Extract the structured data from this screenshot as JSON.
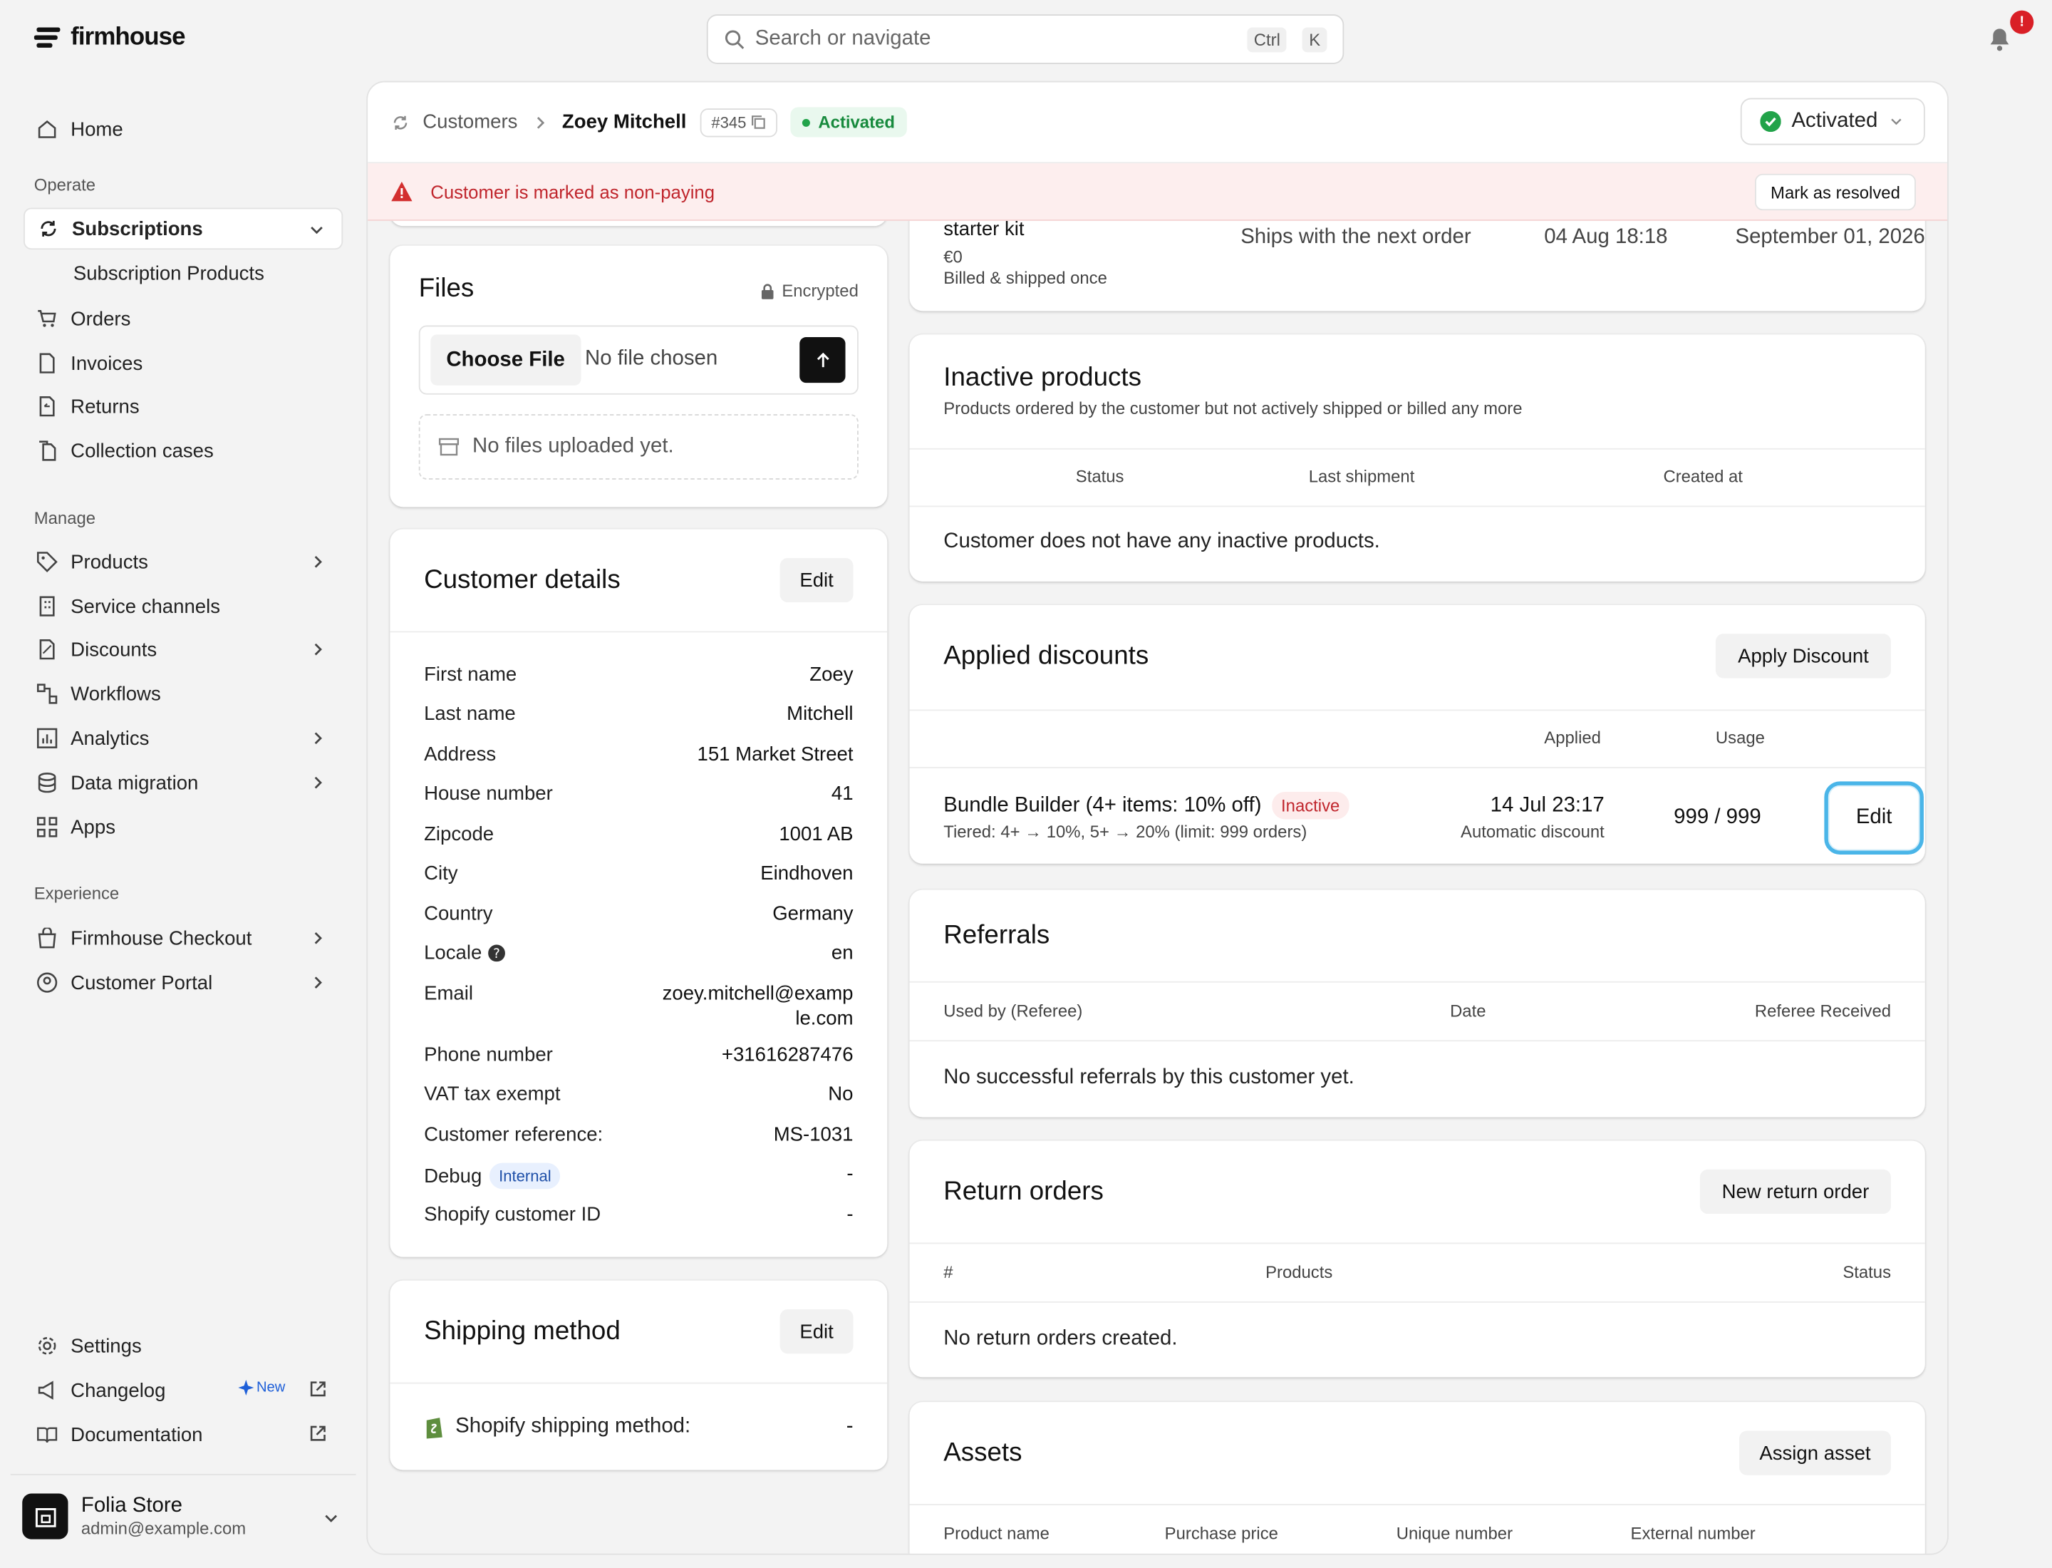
{
  "brand": {
    "name": "firmhouse"
  },
  "search": {
    "placeholder": "Search or navigate",
    "kbd1": "Ctrl",
    "kbd2": "K"
  },
  "notifications": {
    "badge": "!"
  },
  "sidebar": {
    "home": "Home",
    "operate_heading": "Operate",
    "subscriptions": "Subscriptions",
    "subscription_products": "Subscription Products",
    "orders": "Orders",
    "invoices": "Invoices",
    "returns": "Returns",
    "collection_cases": "Collection cases",
    "manage_heading": "Manage",
    "products": "Products",
    "service_channels": "Service channels",
    "discounts": "Discounts",
    "workflows": "Workflows",
    "analytics": "Analytics",
    "data_migration": "Data migration",
    "apps": "Apps",
    "experience_heading": "Experience",
    "firmhouse_checkout": "Firmhouse Checkout",
    "customer_portal": "Customer Portal",
    "settings": "Settings",
    "changelog": "Changelog",
    "changelog_badge": "New",
    "documentation": "Documentation",
    "store_name": "Folia Store",
    "store_email": "admin@example.com"
  },
  "header": {
    "crumb_parent": "Customers",
    "crumb_current": "Zoey Mitchell",
    "customer_id": "#345",
    "status_pill": "Activated",
    "status_dropdown": "Activated"
  },
  "alert": {
    "message": "Customer is marked as non-paying",
    "action": "Mark as resolved"
  },
  "files": {
    "title": "Files",
    "encrypted": "Encrypted",
    "choose_file": "Choose File",
    "no_file": "No file chosen",
    "empty": "No files uploaded yet."
  },
  "customer_details": {
    "title": "Customer details",
    "edit": "Edit",
    "first_name_label": "First name",
    "first_name": "Zoey",
    "last_name_label": "Last name",
    "last_name": "Mitchell",
    "address_label": "Address",
    "address": "151 Market Street",
    "house_number_label": "House number",
    "house_number": "41",
    "zipcode_label": "Zipcode",
    "zipcode": "1001 AB",
    "city_label": "City",
    "city": "Eindhoven",
    "country_label": "Country",
    "country": "Germany",
    "locale_label": "Locale",
    "locale": "en",
    "email_label": "Email",
    "email_1": "zoey.mitchell@examp",
    "email_2": "le.com",
    "phone_label": "Phone number",
    "phone": "+31616287476",
    "vat_label": "VAT tax exempt",
    "vat": "No",
    "reference_label": "Customer reference:",
    "reference": "MS-1031",
    "debug_label": "Debug",
    "debug_badge": "Internal",
    "debug": "-",
    "shopify_id_label": "Shopify customer ID",
    "shopify_id": "-"
  },
  "shipping": {
    "title": "Shipping method",
    "edit": "Edit",
    "label": "Shopify shipping method:",
    "value": "-"
  },
  "starter": {
    "name": "starter kit",
    "price": "€0",
    "billing": "Billed & shipped once",
    "ships": "Ships with the next order",
    "date": "04 Aug 18:18",
    "next": "September 01, 2026"
  },
  "inactive_products": {
    "title": "Inactive products",
    "subtitle": "Products ordered by the customer but not actively shipped or billed any more",
    "col_status": "Status",
    "col_last": "Last shipment",
    "col_created": "Created at",
    "empty": "Customer does not have any inactive products."
  },
  "discounts": {
    "title": "Applied discounts",
    "apply": "Apply Discount",
    "col_applied": "Applied",
    "col_usage": "Usage",
    "name": "Bundle Builder (4+ items: 10% off)",
    "badge": "Inactive",
    "details": "Tiered: 4+ → 10%, 5+ → 20% (limit: 999 orders)",
    "applied": "14 Jul 23:17",
    "type": "Automatic discount",
    "usage": "999 / 999",
    "edit": "Edit"
  },
  "referrals": {
    "title": "Referrals",
    "col_used": "Used by (Referee)",
    "col_date": "Date",
    "col_received": "Referee Received",
    "empty": "No successful referrals by this customer yet."
  },
  "return_orders": {
    "title": "Return orders",
    "new": "New return order",
    "col_num": "#",
    "col_products": "Products",
    "col_status": "Status",
    "empty": "No return orders created."
  },
  "assets": {
    "title": "Assets",
    "assign": "Assign asset",
    "col_name": "Product name",
    "col_price": "Purchase price",
    "col_unique": "Unique number",
    "col_external": "External number"
  }
}
